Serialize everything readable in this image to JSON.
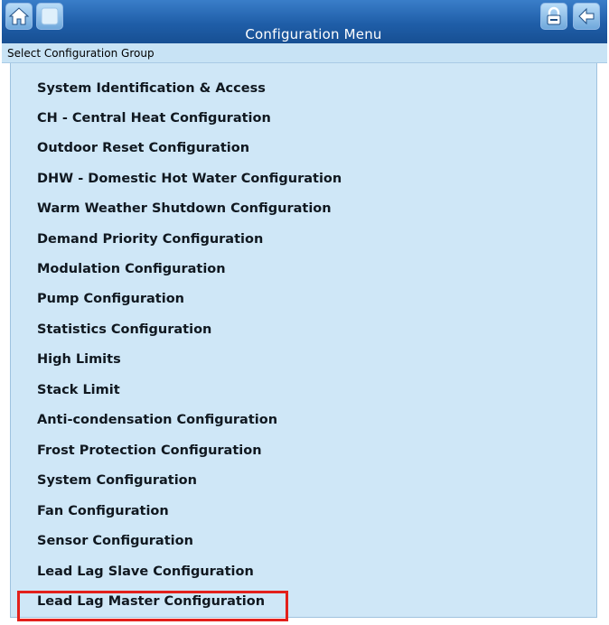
{
  "header": {
    "title": "Configuration Menu",
    "icons": {
      "home": "home-icon",
      "blank": "blank-screen-icon",
      "lock": "lock-icon",
      "back": "back-arrow-icon"
    }
  },
  "subheader": {
    "label": "Select Configuration Group"
  },
  "menu": {
    "items": [
      {
        "label": "System Identification & Access"
      },
      {
        "label": "CH - Central Heat Configuration"
      },
      {
        "label": "Outdoor Reset Configuration"
      },
      {
        "label": "DHW - Domestic Hot Water Configuration"
      },
      {
        "label": "Warm Weather Shutdown Configuration"
      },
      {
        "label": "Demand Priority Configuration"
      },
      {
        "label": "Modulation Configuration"
      },
      {
        "label": "Pump Configuration"
      },
      {
        "label": "Statistics Configuration"
      },
      {
        "label": "High Limits"
      },
      {
        "label": "Stack Limit"
      },
      {
        "label": "Anti-condensation Configuration"
      },
      {
        "label": "Frost Protection Configuration"
      },
      {
        "label": "System Configuration"
      },
      {
        "label": "Fan Configuration"
      },
      {
        "label": "Sensor Configuration"
      },
      {
        "label": "Lead Lag Slave Configuration"
      },
      {
        "label": "Lead Lag Master Configuration"
      }
    ],
    "highlighted_item": "Lead Lag Master Configuration"
  },
  "colors": {
    "header_blue": "#1f5ea8",
    "panel_background": "#cfe7f7",
    "highlight_red": "#e3201b"
  }
}
